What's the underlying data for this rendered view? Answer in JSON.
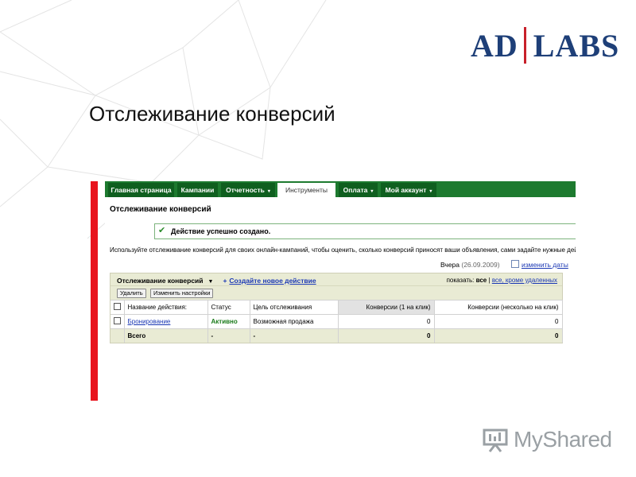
{
  "slide": {
    "title": "Отслеживание конверсий",
    "logo": {
      "left": "AD",
      "right": "LABS"
    },
    "watermark": "MyShared",
    "accent_color": "#e8141d",
    "logo_color": "#1e3f78"
  },
  "nav": {
    "tabs": [
      {
        "label": "Главная страница",
        "has_menu": false,
        "active": false
      },
      {
        "label": "Кампании",
        "has_menu": false,
        "active": false
      },
      {
        "label": "Отчетность",
        "has_menu": true,
        "active": false
      },
      {
        "label": "Инструменты",
        "has_menu": false,
        "active": true
      },
      {
        "label": "Оплата",
        "has_menu": true,
        "active": false
      },
      {
        "label": "Мой аккаунт",
        "has_menu": true,
        "active": false
      }
    ],
    "caret": "▾"
  },
  "page": {
    "title": "Отслеживание конверсий",
    "success_message": "Действие успешно создано.",
    "description": "Используйте отслеживание конверсий для своих онлайн-кампаний, чтобы оценить, сколько конверсий приносят ваши объявления, сами задайте нужные дей",
    "date_range_label": "Вчера",
    "date_value": "(26.09.2009)",
    "change_dates_link": "изменить даты"
  },
  "toolbar": {
    "dropdown_label": "Отслеживание конверсий",
    "dropdown_caret": "▼",
    "create_plus": "+",
    "create_link": "Создайте новое действие",
    "show_label": "показать:",
    "show_all": "все",
    "show_separator": "|",
    "show_except_deleted": "все, кроме удаленных",
    "delete_button": "Удалить",
    "settings_button": "Изменить настройки"
  },
  "table": {
    "columns": [
      "Название действия:",
      "Статус",
      "Цель отслеживания",
      "Конверсии (1 на клик)",
      "Конверсии (несколько на клик)"
    ],
    "rows": [
      {
        "name": "Бронирование",
        "status": "Активно",
        "goal": "Возможная продажа",
        "conv_one": "0",
        "conv_many": "0"
      }
    ],
    "total": {
      "label": "Всего",
      "status": "-",
      "goal": "-",
      "conv_one": "0",
      "conv_many": "0"
    }
  }
}
